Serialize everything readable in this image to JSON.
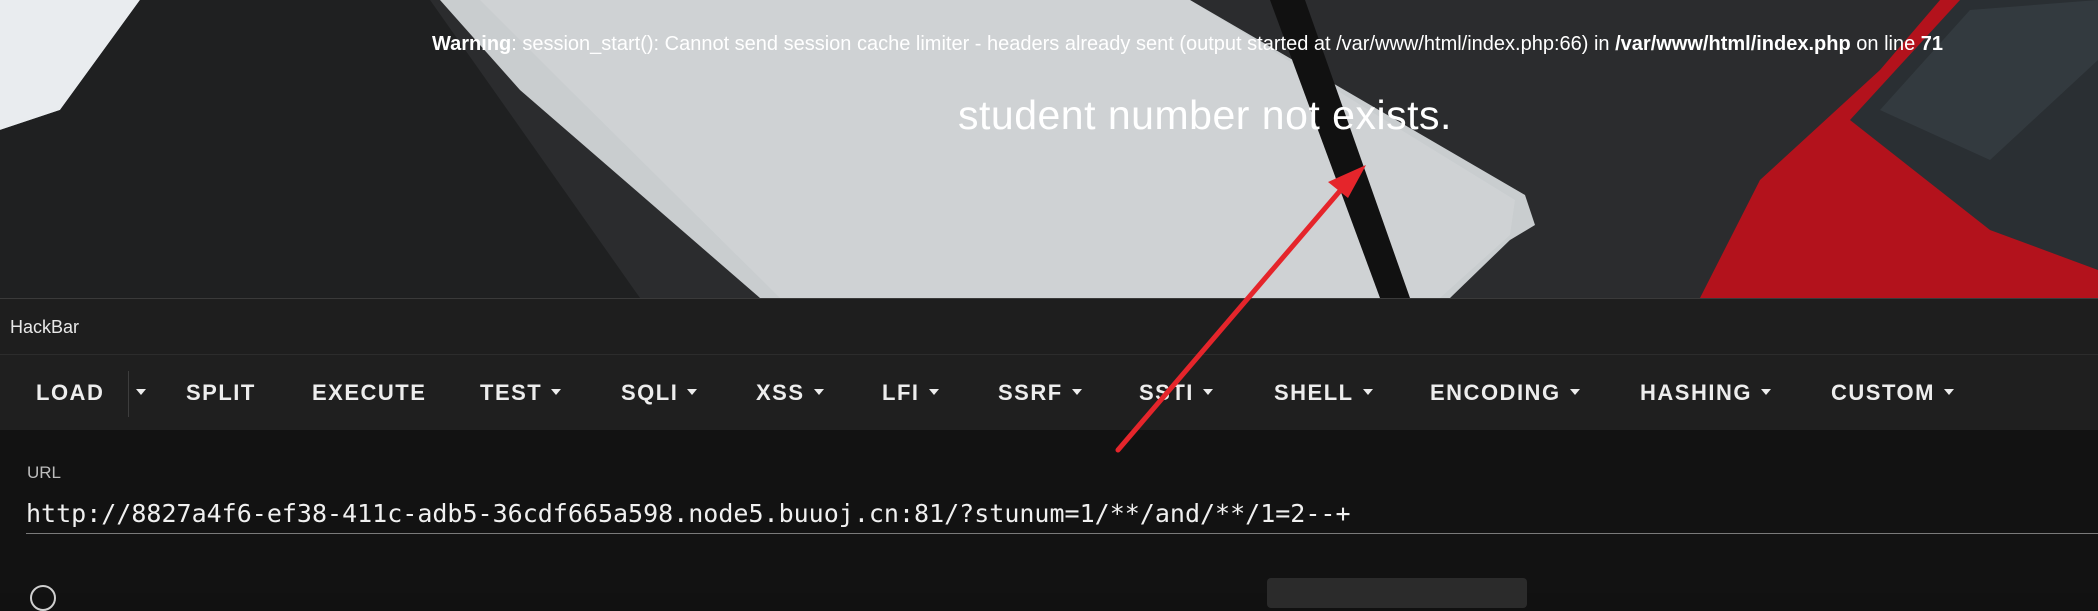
{
  "page": {
    "warning_label": "Warning",
    "warning_text": ": session_start(): Cannot send session cache limiter - headers already sent (output started at /var/www/html/index.php:66) in ",
    "warning_path": "/var/www/html/index.php",
    "warning_line_prefix": " on line ",
    "warning_line": "71",
    "message": "student number not exists."
  },
  "hackbar": {
    "title": "HackBar",
    "toolbar": [
      {
        "label": "LOAD",
        "dropdown": false
      },
      {
        "label": "",
        "dropdown": true
      },
      {
        "label": "SPLIT",
        "dropdown": false
      },
      {
        "label": "EXECUTE",
        "dropdown": false
      },
      {
        "label": "TEST",
        "dropdown": true
      },
      {
        "label": "SQLI",
        "dropdown": true
      },
      {
        "label": "XSS",
        "dropdown": true
      },
      {
        "label": "LFI",
        "dropdown": true
      },
      {
        "label": "SSRF",
        "dropdown": true
      },
      {
        "label": "SSTI",
        "dropdown": true
      },
      {
        "label": "SHELL",
        "dropdown": true
      },
      {
        "label": "ENCODING",
        "dropdown": true
      },
      {
        "label": "HASHING",
        "dropdown": true
      },
      {
        "label": "CUSTOM",
        "dropdown": true
      }
    ],
    "url_label": "URL",
    "url_value": "http://8827a4f6-ef38-411c-adb5-36cdf665a598.node5.buuoj.cn:81/?stunum=1/**/and/**/1=2--+"
  },
  "colors": {
    "annotation_arrow": "#e5252b",
    "panel_background": "#121212",
    "toolbar_background": "#1f1f1f"
  }
}
